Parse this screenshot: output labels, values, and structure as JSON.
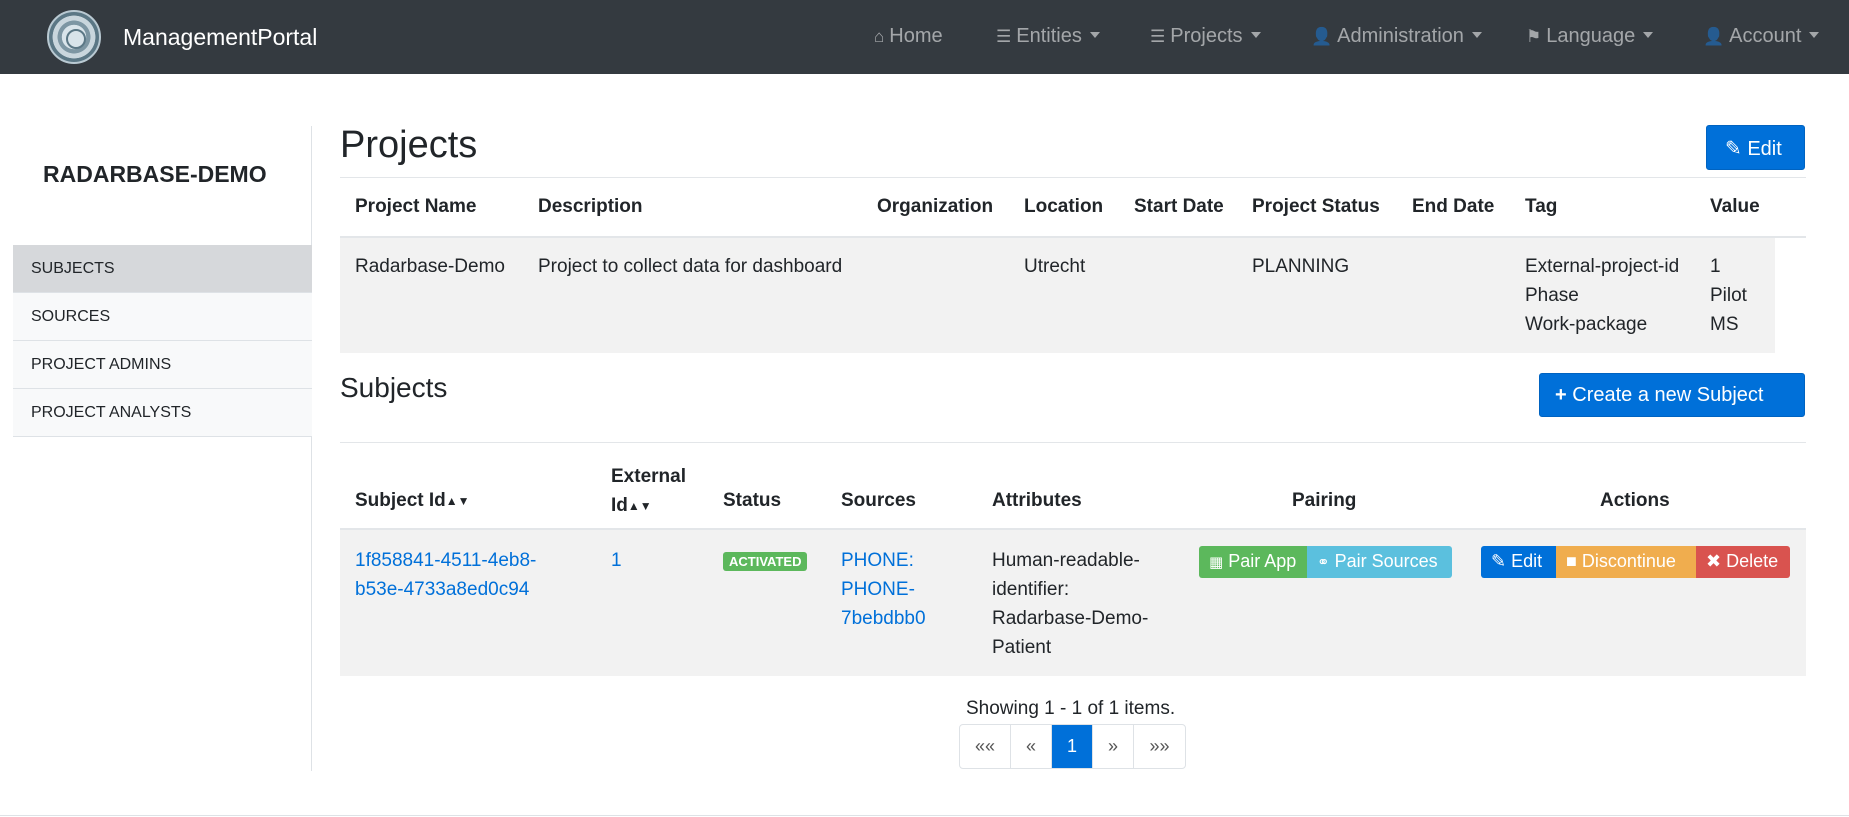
{
  "navbar": {
    "brand": "ManagementPortal",
    "items": [
      {
        "label": "Home",
        "icon": "home-icon"
      },
      {
        "label": "Entities",
        "icon": "list-icon"
      },
      {
        "label": "Projects",
        "icon": "list-icon"
      },
      {
        "label": "Administration",
        "icon": "user-plus-icon"
      },
      {
        "label": "Language",
        "icon": "flag-icon"
      },
      {
        "label": "Account",
        "icon": "user-icon"
      }
    ]
  },
  "sidebar": {
    "title": "RADARBASE-DEMO",
    "items": [
      {
        "label": "SUBJECTS"
      },
      {
        "label": "SOURCES"
      },
      {
        "label": "PROJECT ADMINS"
      },
      {
        "label": "PROJECT ANALYSTS"
      }
    ]
  },
  "projects": {
    "title": "Projects",
    "edit_label": "Edit",
    "headers": [
      "Project Name",
      "Description",
      "Organization",
      "Location",
      "Start Date",
      "Project Status",
      "End Date",
      "Tag",
      "Value"
    ],
    "row": {
      "name": "Radarbase-Demo",
      "description": "Project to collect data for dashboard",
      "organization": "",
      "location": "Utrecht",
      "start_date": "",
      "status": "PLANNING",
      "end_date": "",
      "tags": [
        "External-project-id",
        "Phase",
        "Work-package"
      ],
      "values": [
        "1",
        "Pilot",
        "MS"
      ]
    }
  },
  "subjects": {
    "title": "Subjects",
    "create_label": "Create a new Subject",
    "headers": {
      "subject_id": "Subject Id",
      "external_line1": "External",
      "external_line2": "Id",
      "status": "Status",
      "sources": "Sources",
      "attributes": "Attributes",
      "pairing": "Pairing",
      "actions": "Actions"
    },
    "row": {
      "id_line1": "1f858841-4511-4eb8-",
      "id_line2": "b53e-4733a8ed0c94",
      "external_id": "1",
      "status": "ACTIVATED",
      "source_line1": "PHONE:",
      "source_line2": "PHONE-",
      "source_line3": "7bebdbb0",
      "attr_line1": "Human-readable-",
      "attr_line2": "identifier:",
      "attr_line3": "Radarbase-Demo-",
      "attr_line4": "Patient",
      "pair_app": "Pair App",
      "pair_sources": "Pair Sources",
      "edit": "Edit",
      "discontinue": "Discontinue",
      "delete": "Delete"
    },
    "summary": "Showing 1 - 1 of 1 items.",
    "pagination": [
      "««",
      "«",
      "1",
      "»",
      "»»"
    ]
  },
  "colors": {
    "navbar": "#343a40",
    "primary": "#0070d9",
    "success": "#5cb85c",
    "info": "#5bc0de",
    "warning": "#f0ad4e",
    "danger": "#d9534f"
  }
}
